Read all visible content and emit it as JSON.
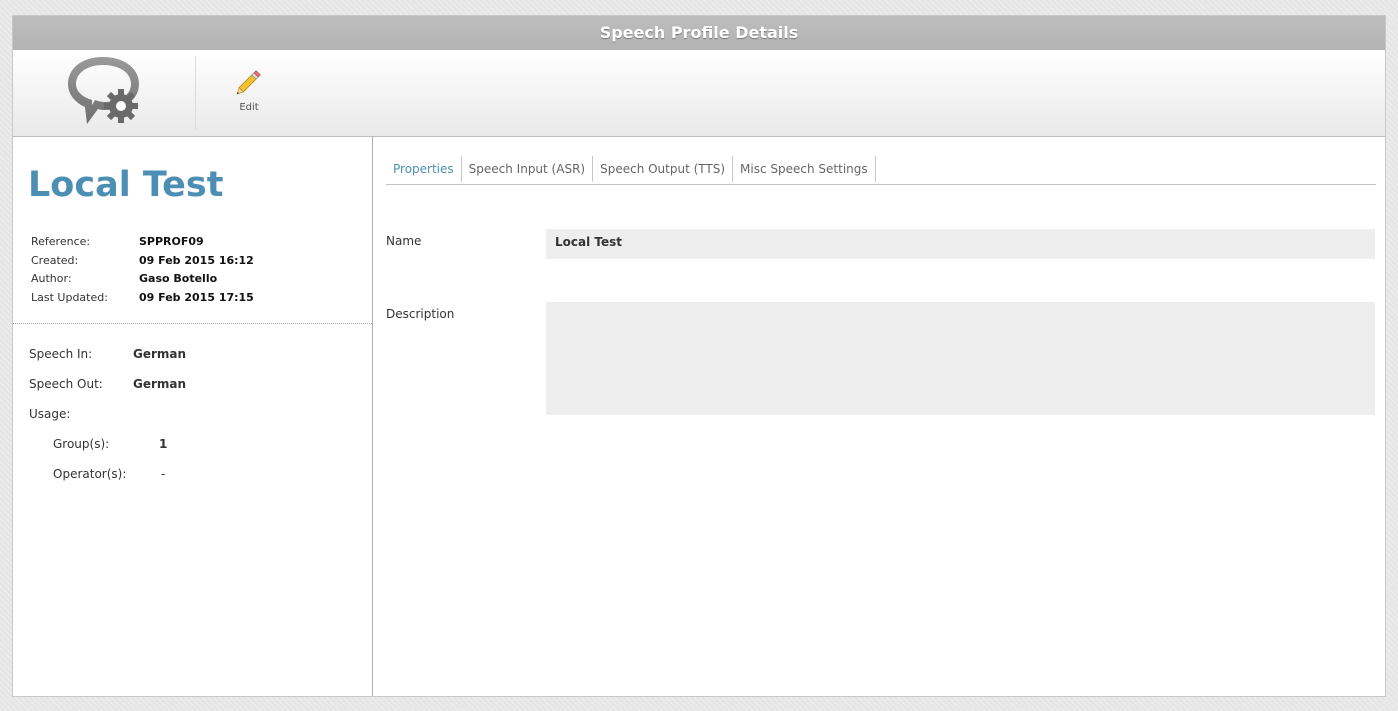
{
  "window": {
    "title": "Speech Profile Details"
  },
  "toolbar": {
    "edit_label": "Edit"
  },
  "profile": {
    "title": "Local Test",
    "meta": [
      {
        "label": "Reference:",
        "value": "SPPROF09"
      },
      {
        "label": "Created:",
        "value": "09 Feb 2015 16:12"
      },
      {
        "label": "Author:",
        "value": "Gaso Botello"
      },
      {
        "label": "Last Updated:",
        "value": "09 Feb 2015 17:15"
      }
    ],
    "speech_in": {
      "label": "Speech In:",
      "value": "German"
    },
    "speech_out": {
      "label": "Speech Out:",
      "value": "German"
    },
    "usage": {
      "label": "Usage:",
      "groups": {
        "label": "Group(s):",
        "value": "1"
      },
      "operators": {
        "label": "Operator(s):",
        "value": "-"
      }
    }
  },
  "tabs": [
    {
      "label": "Properties",
      "active": true
    },
    {
      "label": "Speech Input (ASR)",
      "active": false
    },
    {
      "label": "Speech Output (TTS)",
      "active": false
    },
    {
      "label": "Misc Speech Settings",
      "active": false
    }
  ],
  "form": {
    "name": {
      "label": "Name",
      "value": "Local Test"
    },
    "description": {
      "label": "Description",
      "value": ""
    }
  },
  "colors": {
    "accent": "#4d8fb4",
    "titlebar": "#b8b8b8",
    "field_bg": "#eeeeee"
  }
}
